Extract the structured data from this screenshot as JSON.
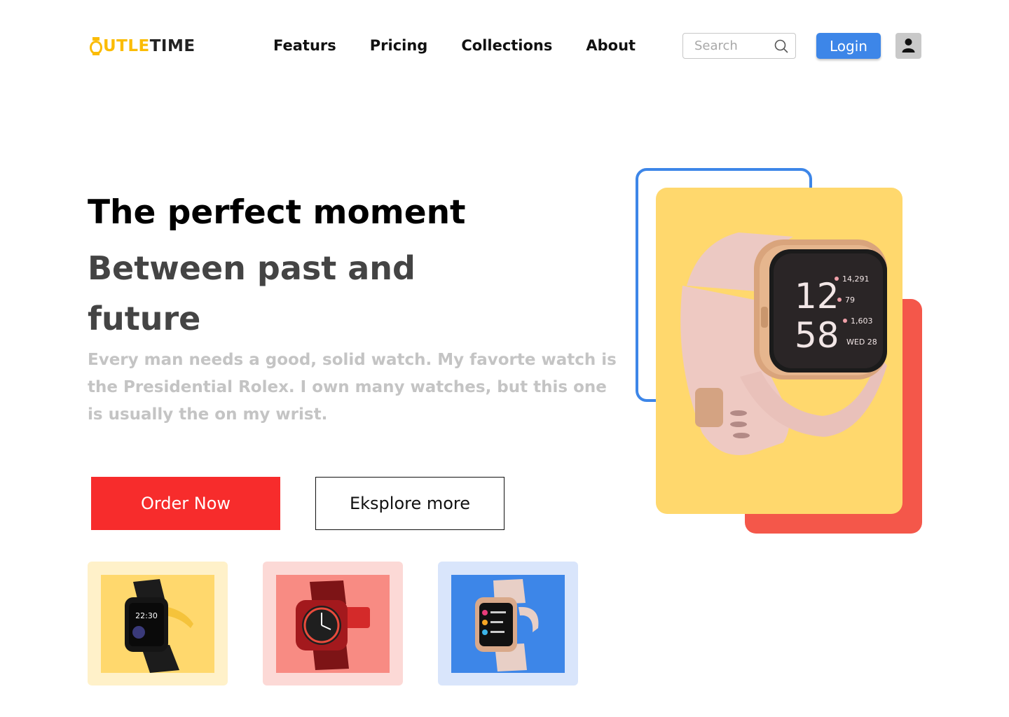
{
  "brand": {
    "logo_o": "O",
    "logo_part1": "UTLE",
    "logo_part2": "TIME"
  },
  "nav": {
    "items": [
      "Featurs",
      "Pricing",
      "Collections",
      "About"
    ]
  },
  "search": {
    "placeholder": "Search",
    "value": ""
  },
  "header": {
    "login_label": "Login"
  },
  "hero": {
    "title": "The perfect moment",
    "subtitle": "Between past and future",
    "description": "Every man needs a good, solid watch. My favorte watch is the Presidential Rolex. I own many watches, but this one is usually the on my wrist.",
    "order_label": "Order Now",
    "explore_label": "Eksplore more"
  },
  "feature_watch": {
    "time_hour": "12",
    "time_min": "58",
    "steps": "14,291",
    "heart": "79",
    "calories": "1,603",
    "date": "WED 28"
  },
  "thumbnails": [
    {
      "name": "black-smartwatch",
      "bg": "#fff1c9",
      "inner": "#ffd86d",
      "screen": "22:30"
    },
    {
      "name": "red-mesh-watch",
      "bg": "#fcd9d6",
      "inner": "#f88b83",
      "screen": ""
    },
    {
      "name": "pink-smartwatch",
      "bg": "#d9e5fb",
      "inner": "#3d86e8",
      "screen": ""
    }
  ],
  "colors": {
    "accent_blue": "#3d86e8",
    "order_red": "#f72c2c",
    "logo_yellow": "#FBBC05",
    "card_yellow": "#ffd86d",
    "block_red": "#f4574a"
  }
}
